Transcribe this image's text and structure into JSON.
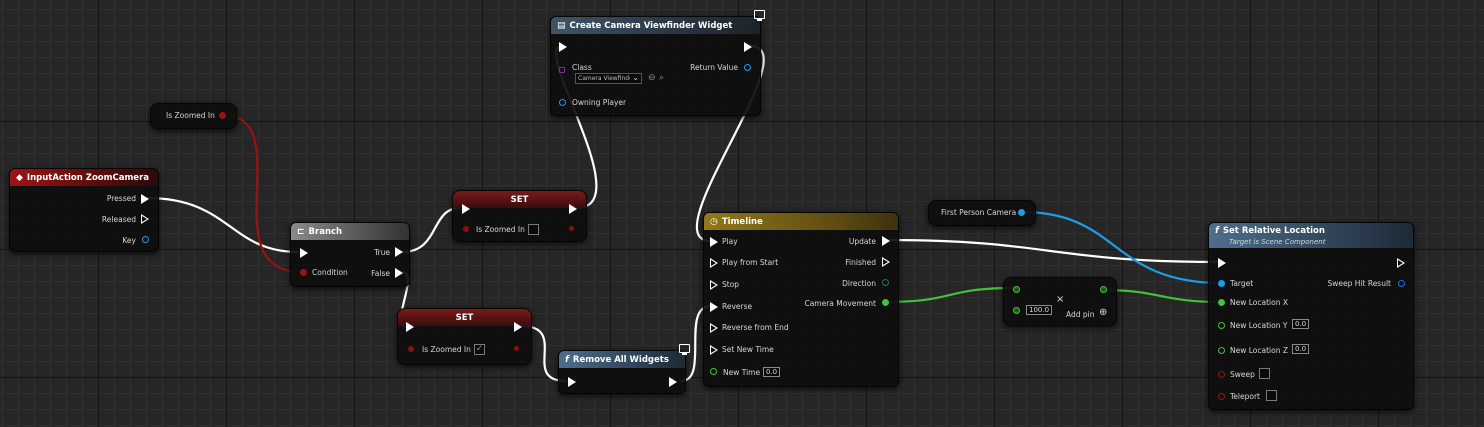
{
  "colors": {
    "exec": "#ffffff",
    "bool": "#9b1212",
    "object": "#1e9ce6",
    "float": "#41c23a",
    "class": "#7a2ea8"
  },
  "nodes": {
    "is_zoomed_get": {
      "label": "Is Zoomed In"
    },
    "first_person_camera": {
      "label": "First Person Camera"
    },
    "input_action": {
      "title": "InputAction ZoomCamera",
      "icon": "input-action-icon",
      "pressed": "Pressed",
      "released": "Released",
      "key": "Key"
    },
    "branch": {
      "title": "Branch",
      "icon": "branch-icon",
      "condition": "Condition",
      "true_label": "True",
      "false_label": "False"
    },
    "set_top": {
      "title": "SET",
      "var": "Is Zoomed In",
      "checked": false
    },
    "set_bottom": {
      "title": "SET",
      "var": "Is Zoomed In",
      "checked": true
    },
    "create_widget": {
      "title": "Create Camera Viewfinder Widget",
      "class_label": "Class",
      "class_value": "Camera Viewfinder",
      "return_value": "Return Value",
      "owning_player": "Owning Player"
    },
    "remove_widgets": {
      "title": "Remove All Widgets"
    },
    "timeline": {
      "title": "Timeline",
      "play": "Play",
      "play_from_start": "Play from Start",
      "stop": "Stop",
      "reverse": "Reverse",
      "reverse_from_end": "Reverse from End",
      "set_new_time": "Set New Time",
      "new_time": "New Time",
      "new_time_value": "0.0",
      "update": "Update",
      "finished": "Finished",
      "direction": "Direction",
      "camera_movement": "Camera Movement"
    },
    "make_value": {
      "value": "100.0",
      "add_pin": "Add pin"
    },
    "set_relative_location": {
      "title": "Set Relative Location",
      "subtitle": "Target is Scene Component",
      "target": "Target",
      "new_x": "New Location X",
      "new_y": "New Location Y",
      "new_y_value": "0.0",
      "new_z": "New Location Z",
      "new_z_value": "0.0",
      "sweep": "Sweep",
      "teleport": "Teleport",
      "sweep_hit_result": "Sweep Hit Result"
    }
  }
}
